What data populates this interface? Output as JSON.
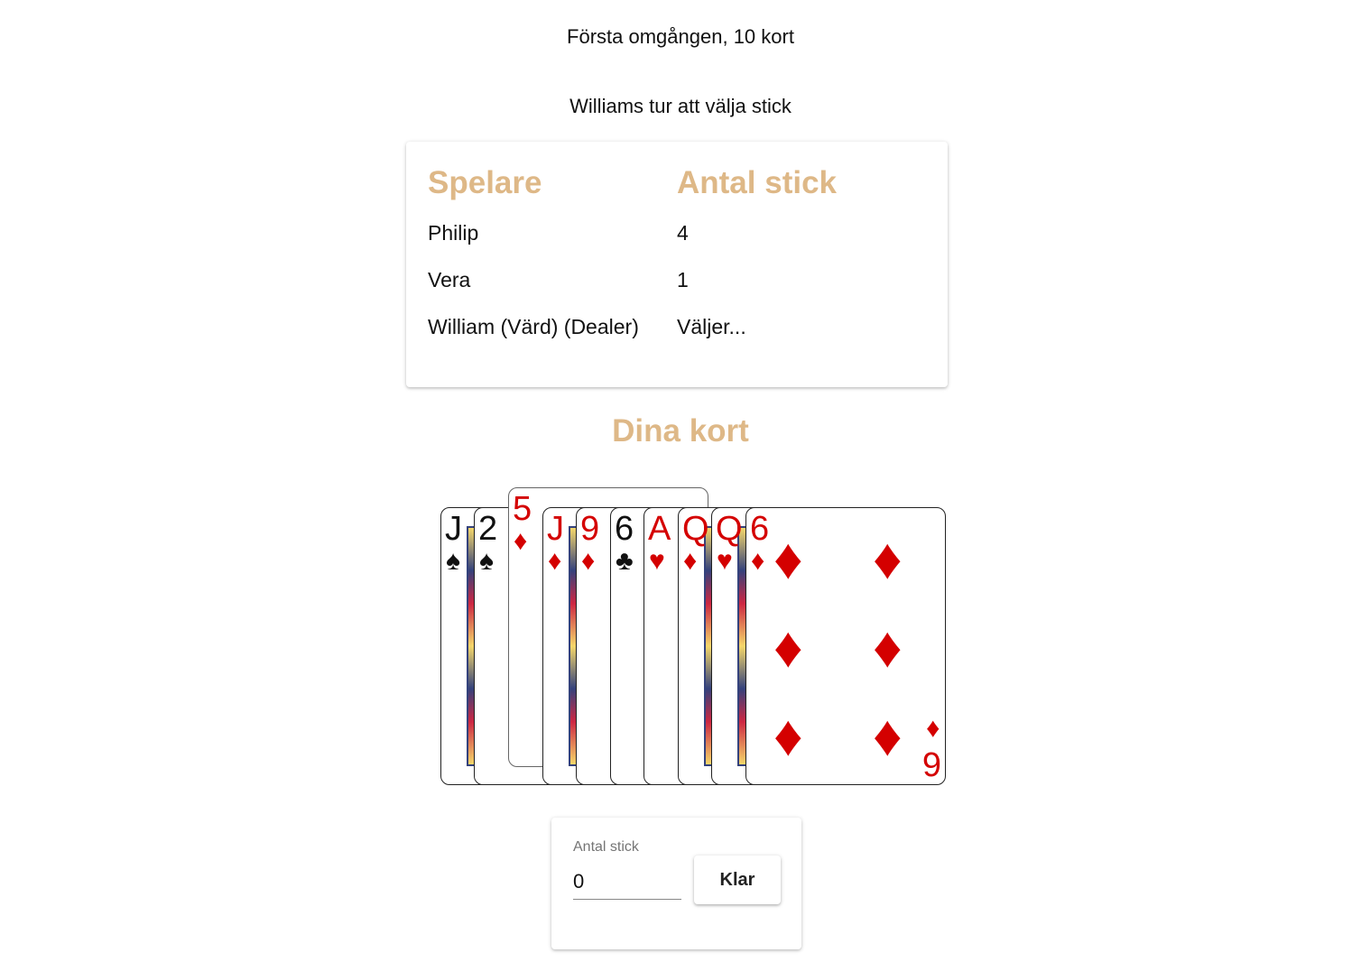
{
  "header": {
    "round_title": "Första omgången, 10 kort",
    "turn_text": "Williams tur att välja stick"
  },
  "colors": {
    "accent": "#deb887",
    "red_suit": "#d40000",
    "black_suit": "#111111"
  },
  "scoreboard": {
    "headers": [
      "Spelare",
      "Antal stick"
    ],
    "rows": [
      {
        "player": "Philip",
        "tricks": "4"
      },
      {
        "player": "Vera",
        "tricks": "1"
      },
      {
        "player": "William (Värd) (Dealer)",
        "tricks": "Väljer..."
      }
    ]
  },
  "hand": {
    "title": "Dina kort",
    "cards": [
      {
        "rank": "J",
        "suit": "♠",
        "color": "black",
        "selected": false
      },
      {
        "rank": "2",
        "suit": "♠",
        "color": "black",
        "selected": false
      },
      {
        "rank": "5",
        "suit": "♦",
        "color": "red",
        "selected": true
      },
      {
        "rank": "J",
        "suit": "♦",
        "color": "red",
        "selected": false
      },
      {
        "rank": "9",
        "suit": "♦",
        "color": "red",
        "selected": false
      },
      {
        "rank": "6",
        "suit": "♣",
        "color": "black",
        "selected": false
      },
      {
        "rank": "A",
        "suit": "♥",
        "color": "red",
        "selected": false
      },
      {
        "rank": "Q",
        "suit": "♦",
        "color": "red",
        "selected": false
      },
      {
        "rank": "Q",
        "suit": "♥",
        "color": "red",
        "selected": false
      },
      {
        "rank": "6",
        "suit": "♦",
        "color": "red",
        "selected": false
      }
    ]
  },
  "bid": {
    "label": "Antal stick",
    "value": "0",
    "button_label": "Klar"
  }
}
